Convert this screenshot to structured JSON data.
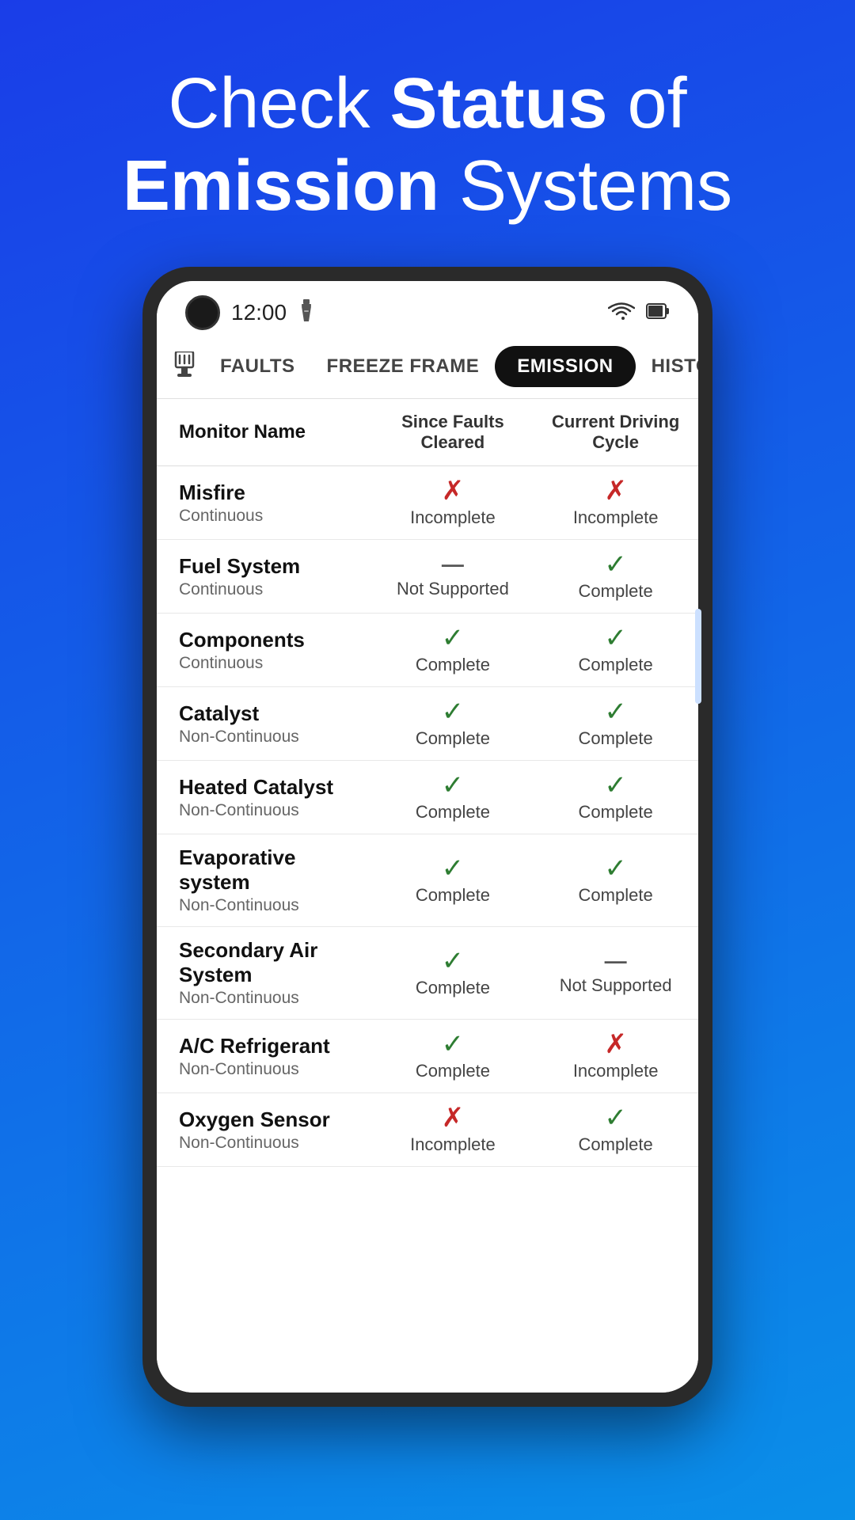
{
  "hero": {
    "line1": "Check ",
    "bold1": "Status",
    "line1end": " of",
    "line2bold": "Emission",
    "line2end": " Systems"
  },
  "status_bar": {
    "time": "12:00",
    "wifi_icon": "wifi",
    "battery_icon": "battery"
  },
  "nav": {
    "icon": "⊟",
    "tabs": [
      {
        "label": "Faults",
        "active": false
      },
      {
        "label": "Freeze Frame",
        "active": false
      },
      {
        "label": "Emission",
        "active": true
      },
      {
        "label": "History",
        "active": false
      }
    ]
  },
  "table": {
    "headers": [
      "Monitor Name",
      "Since Faults Cleared",
      "Current Driving Cycle"
    ],
    "rows": [
      {
        "name": "Misfire",
        "type": "Continuous",
        "col1_icon": "✗",
        "col1_icon_class": "icon-incomplete",
        "col1_text": "Incomplete",
        "col2_icon": "✗",
        "col2_icon_class": "icon-incomplete",
        "col2_text": "Incomplete"
      },
      {
        "name": "Fuel System",
        "type": "Continuous",
        "col1_icon": "—",
        "col1_icon_class": "icon-not-supported",
        "col1_text": "Not Supported",
        "col2_icon": "✓",
        "col2_icon_class": "icon-complete",
        "col2_text": "Complete"
      },
      {
        "name": "Components",
        "type": "Continuous",
        "col1_icon": "✓",
        "col1_icon_class": "icon-complete",
        "col1_text": "Complete",
        "col2_icon": "✓",
        "col2_icon_class": "icon-complete",
        "col2_text": "Complete"
      },
      {
        "name": "Catalyst",
        "type": "Non-Continuous",
        "col1_icon": "✓",
        "col1_icon_class": "icon-complete",
        "col1_text": "Complete",
        "col2_icon": "✓",
        "col2_icon_class": "icon-complete",
        "col2_text": "Complete"
      },
      {
        "name": "Heated Catalyst",
        "type": "Non-Continuous",
        "col1_icon": "✓",
        "col1_icon_class": "icon-complete",
        "col1_text": "Complete",
        "col2_icon": "✓",
        "col2_icon_class": "icon-complete",
        "col2_text": "Complete"
      },
      {
        "name": "Evaporative system",
        "type": "Non-Continuous",
        "col1_icon": "✓",
        "col1_icon_class": "icon-complete",
        "col1_text": "Complete",
        "col2_icon": "✓",
        "col2_icon_class": "icon-complete",
        "col2_text": "Complete"
      },
      {
        "name": "Secondary Air System",
        "type": "Non-Continuous",
        "col1_icon": "✓",
        "col1_icon_class": "icon-complete",
        "col1_text": "Complete",
        "col2_icon": "—",
        "col2_icon_class": "icon-not-supported",
        "col2_text": "Not Supported"
      },
      {
        "name": "A/C Refrigerant",
        "type": "Non-Continuous",
        "col1_icon": "✓",
        "col1_icon_class": "icon-complete",
        "col1_text": "Complete",
        "col2_icon": "✗",
        "col2_icon_class": "icon-incomplete",
        "col2_text": "Incomplete"
      },
      {
        "name": "Oxygen Sensor",
        "type": "Non-Continuous",
        "col1_icon": "✗",
        "col1_icon_class": "icon-incomplete",
        "col1_text": "Incomplete",
        "col2_icon": "✓",
        "col2_icon_class": "icon-complete",
        "col2_text": "Complete"
      }
    ]
  }
}
